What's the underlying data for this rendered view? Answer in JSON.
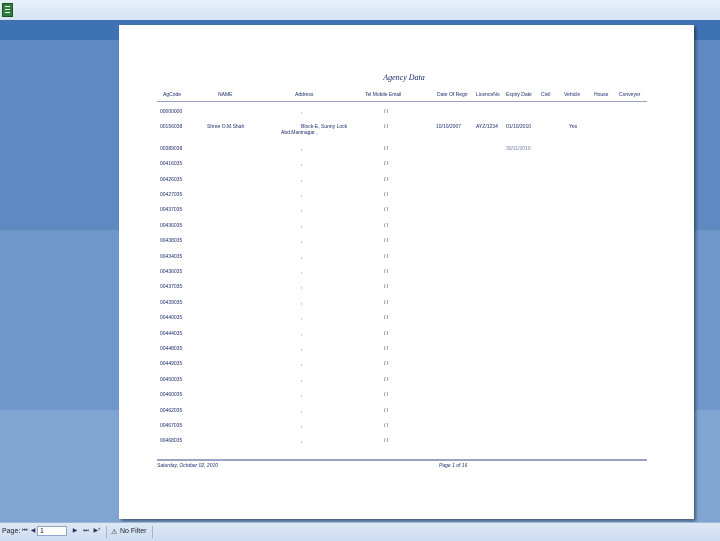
{
  "report": {
    "title": "Agency Data",
    "columns": [
      "AgCode",
      "NAME",
      "Address",
      "Tel Mobile Email",
      "Date Of Regn",
      "LicenceNo",
      "Expiry Date",
      "Civil",
      "Vehicle",
      "House",
      "Conveyer"
    ],
    "rows": [
      {
        "code": "00000000",
        "name": "",
        "address": ",",
        "email": "/ /",
        "date": "",
        "licence": "",
        "expiry": "",
        "vehicle": ""
      },
      {
        "code": "00156038",
        "name": "Shree O.M.Shah",
        "address": "Block-E, Sunny Lock",
        "address2": "Abd.Maninagar ,",
        "email": "/ /",
        "date": "10/10/2007",
        "licence": "AYZ/1234",
        "expiry": "01/10/2010",
        "vehicle": "Yes"
      },
      {
        "code": "00389038",
        "name": "",
        "address": ",",
        "email": "/ /",
        "date": "",
        "licence": "",
        "expiry": "30/11/2010",
        "vehicle": ""
      },
      {
        "code": "00416035",
        "name": "",
        "address": ",",
        "email": "/ /",
        "date": "",
        "licence": "",
        "expiry": "",
        "vehicle": ""
      },
      {
        "code": "00426035",
        "name": "",
        "address": ",",
        "email": "/ /",
        "date": "",
        "licence": "",
        "expiry": "",
        "vehicle": ""
      },
      {
        "code": "00427035",
        "name": "",
        "address": ",",
        "email": "/ /",
        "date": "",
        "licence": "",
        "expiry": "",
        "vehicle": ""
      },
      {
        "code": "00437035",
        "name": "",
        "address": ",",
        "email": "/ /",
        "date": "",
        "licence": "",
        "expiry": "",
        "vehicle": ""
      },
      {
        "code": "00436035",
        "name": "",
        "address": ",",
        "email": "/ /",
        "date": "",
        "licence": "",
        "expiry": "",
        "vehicle": ""
      },
      {
        "code": "00438035",
        "name": "",
        "address": ",",
        "email": "/ /",
        "date": "",
        "licence": "",
        "expiry": "",
        "vehicle": ""
      },
      {
        "code": "00434035",
        "name": "",
        "address": ",",
        "email": "/ /",
        "date": "",
        "licence": "",
        "expiry": "",
        "vehicle": ""
      },
      {
        "code": "00436035",
        "name": "",
        "address": ",",
        "email": "/ /",
        "date": "",
        "licence": "",
        "expiry": "",
        "vehicle": ""
      },
      {
        "code": "00437035",
        "name": "",
        "address": ",",
        "email": "/ /",
        "date": "",
        "licence": "",
        "expiry": "",
        "vehicle": ""
      },
      {
        "code": "00439035",
        "name": "",
        "address": ",",
        "email": "/ /",
        "date": "",
        "licence": "",
        "expiry": "",
        "vehicle": ""
      },
      {
        "code": "00440035",
        "name": "",
        "address": ",",
        "email": "/ /",
        "date": "",
        "licence": "",
        "expiry": "",
        "vehicle": ""
      },
      {
        "code": "00444035",
        "name": "",
        "address": ",",
        "email": "/ /",
        "date": "",
        "licence": "",
        "expiry": "",
        "vehicle": ""
      },
      {
        "code": "00448035",
        "name": "",
        "address": ",",
        "email": "/ /",
        "date": "",
        "licence": "",
        "expiry": "",
        "vehicle": ""
      },
      {
        "code": "00449035",
        "name": "",
        "address": ",",
        "email": "/ /",
        "date": "",
        "licence": "",
        "expiry": "",
        "vehicle": ""
      },
      {
        "code": "00450035",
        "name": "",
        "address": ",",
        "email": "/ /",
        "date": "",
        "licence": "",
        "expiry": "",
        "vehicle": ""
      },
      {
        "code": "00460035",
        "name": "",
        "address": ",",
        "email": "/ /",
        "date": "",
        "licence": "",
        "expiry": "",
        "vehicle": ""
      },
      {
        "code": "00462035",
        "name": "",
        "address": ",",
        "email": "/ /",
        "date": "",
        "licence": "",
        "expiry": "",
        "vehicle": ""
      },
      {
        "code": "00467035",
        "name": "",
        "address": ",",
        "email": "/ /",
        "date": "",
        "licence": "",
        "expiry": "",
        "vehicle": ""
      },
      {
        "code": "00468035",
        "name": "",
        "address": ",",
        "email": "/ /",
        "date": "",
        "licence": "",
        "expiry": "",
        "vehicle": ""
      }
    ],
    "footer_date": "Saturday, October 02, 2010",
    "footer_page": "Page 1 of 16"
  },
  "statusbar": {
    "page_label": "Page:",
    "page_value": "1",
    "filter_label": "No Filter"
  }
}
